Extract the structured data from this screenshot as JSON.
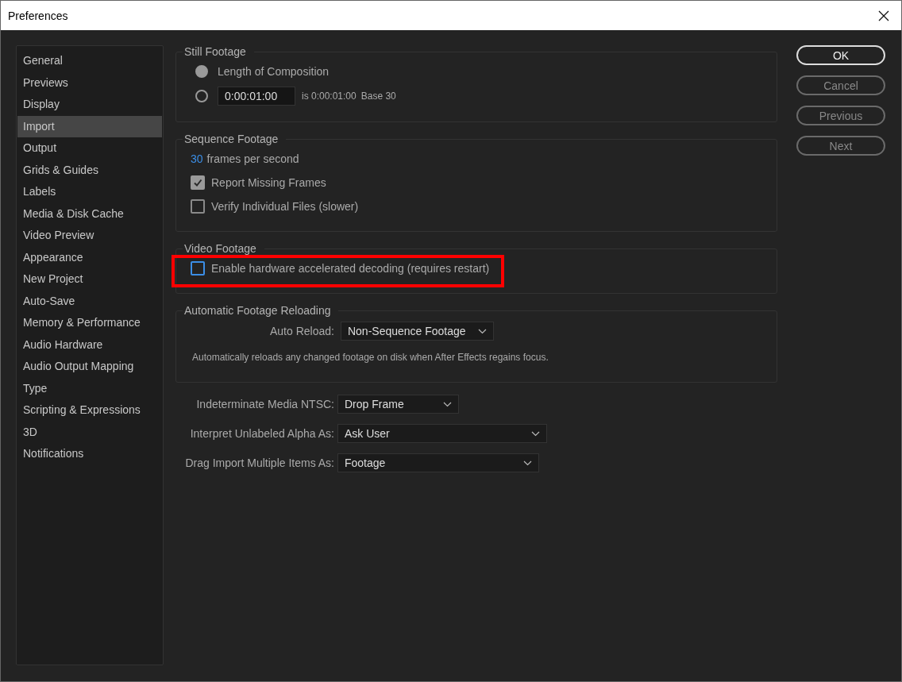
{
  "window": {
    "title": "Preferences"
  },
  "sidebar": {
    "items": [
      {
        "label": "General",
        "selected": false
      },
      {
        "label": "Previews",
        "selected": false
      },
      {
        "label": "Display",
        "selected": false
      },
      {
        "label": "Import",
        "selected": true
      },
      {
        "label": "Output",
        "selected": false
      },
      {
        "label": "Grids & Guides",
        "selected": false
      },
      {
        "label": "Labels",
        "selected": false
      },
      {
        "label": "Media & Disk Cache",
        "selected": false
      },
      {
        "label": "Video Preview",
        "selected": false
      },
      {
        "label": "Appearance",
        "selected": false
      },
      {
        "label": "New Project",
        "selected": false
      },
      {
        "label": "Auto-Save",
        "selected": false
      },
      {
        "label": "Memory & Performance",
        "selected": false
      },
      {
        "label": "Audio Hardware",
        "selected": false
      },
      {
        "label": "Audio Output Mapping",
        "selected": false
      },
      {
        "label": "Type",
        "selected": false
      },
      {
        "label": "Scripting & Expressions",
        "selected": false
      },
      {
        "label": "3D",
        "selected": false
      },
      {
        "label": "Notifications",
        "selected": false
      }
    ]
  },
  "groups": [
    {
      "title": "Still Footage",
      "rows": [
        {
          "kind": "radio",
          "label": "Length of Composition",
          "selected": true
        },
        {
          "kind": "radio_time",
          "selected": false,
          "value": "0:00:01:00",
          "note": "is 0:00:01:00",
          "base": "Base 30"
        }
      ]
    },
    {
      "title": "Sequence Footage",
      "rows": [
        {
          "kind": "rate",
          "value": "30",
          "label": "frames per second"
        },
        {
          "kind": "checkbox",
          "label": "Report Missing Frames",
          "checked": true,
          "focused": false,
          "highlighted": false
        },
        {
          "kind": "checkbox",
          "label": "Verify Individual Files (slower)",
          "checked": false,
          "focused": false,
          "highlighted": false
        }
      ]
    },
    {
      "title": "Video Footage",
      "rows": [
        {
          "kind": "checkbox",
          "label": "Enable hardware accelerated decoding (requires restart)",
          "checked": false,
          "focused": true,
          "highlighted": true
        }
      ]
    },
    {
      "title": "Automatic Footage Reloading",
      "rows": [
        {
          "kind": "select",
          "label": "Auto Reload:",
          "value": "Non-Sequence Footage"
        },
        {
          "kind": "note",
          "text": "Automatically reloads any changed footage on disk when After Effects regains focus."
        }
      ]
    }
  ],
  "fields": [
    {
      "label": "Indeterminate Media NTSC:",
      "value": "Drop Frame"
    },
    {
      "label": "Interpret Unlabeled Alpha As:",
      "value": "Ask User"
    },
    {
      "label": "Drag Import Multiple Items As:",
      "value": "Footage"
    }
  ],
  "buttons": [
    {
      "label": "OK",
      "default": true
    },
    {
      "label": "Cancel",
      "default": false
    },
    {
      "label": "Previous",
      "default": false
    },
    {
      "label": "Next",
      "default": false
    }
  ]
}
